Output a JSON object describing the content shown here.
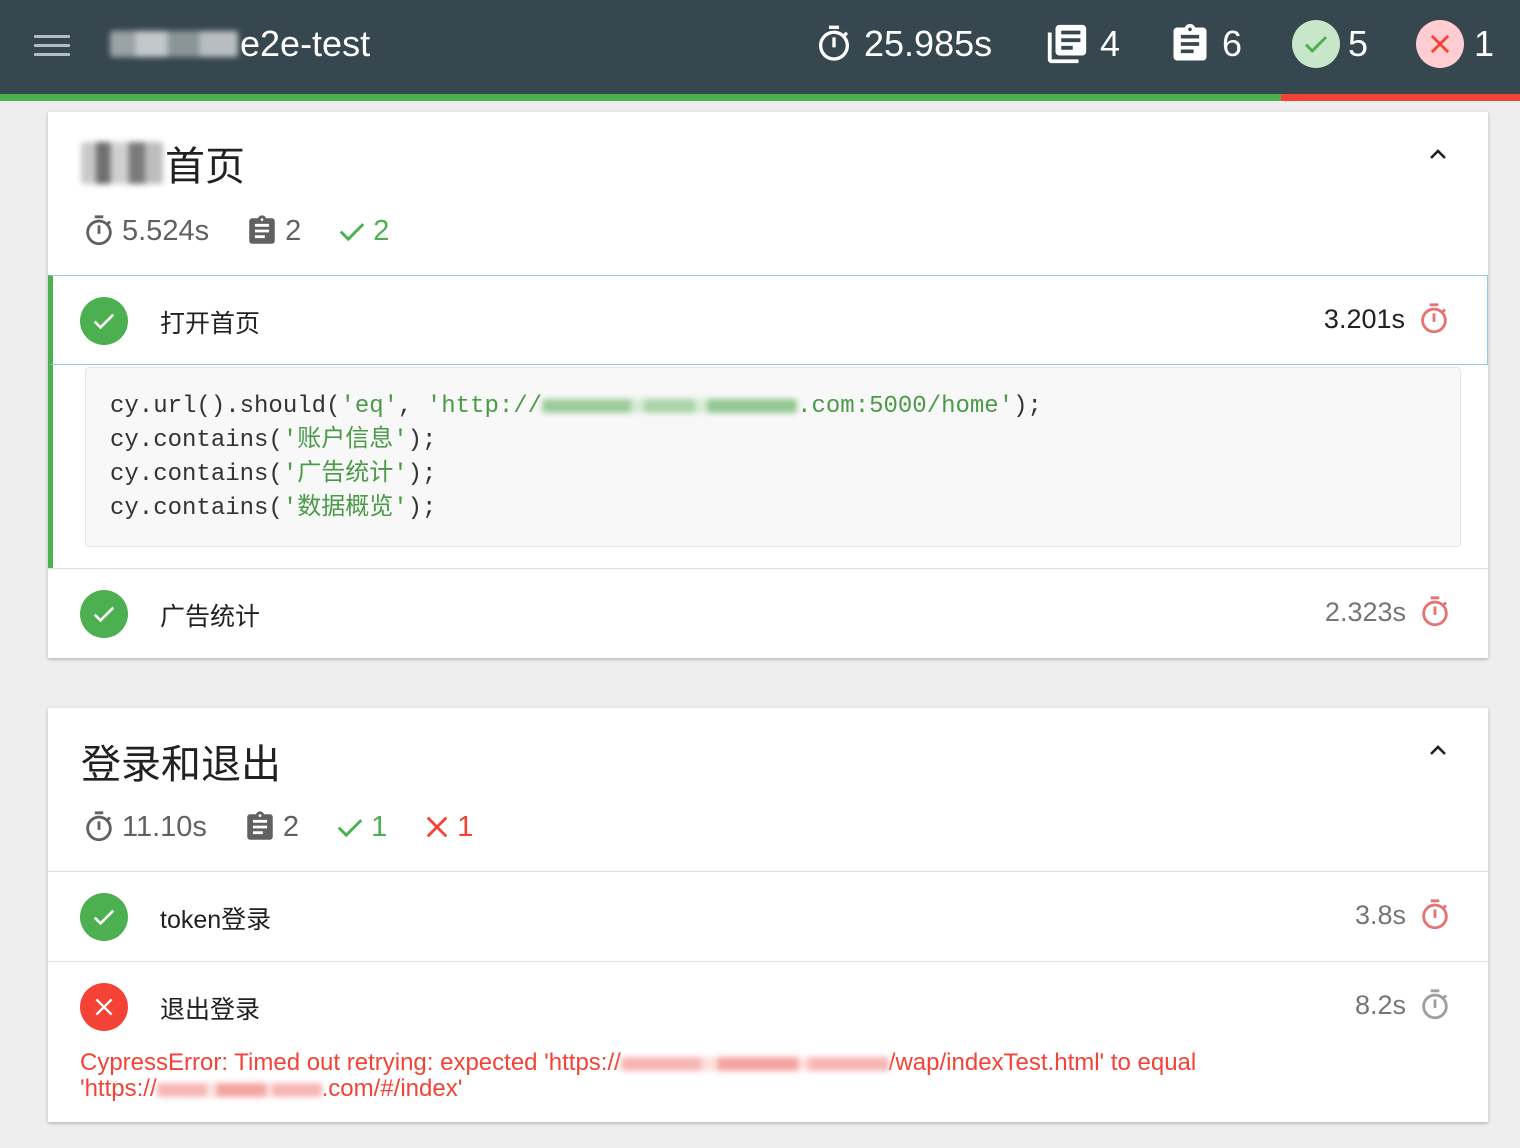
{
  "header": {
    "title": "e2e-test",
    "duration": "25.985s",
    "suites_count": "4",
    "tests_count": "6",
    "passed_count": "5",
    "failed_count": "1"
  },
  "progress": {
    "passed_fraction": 0.843,
    "failed_fraction": 0.157
  },
  "colors": {
    "topbar": "#37474f",
    "pass": "#4caf50",
    "fail": "#f44336",
    "pending_blue": "#90caf9"
  },
  "suites": [
    {
      "title": "首页",
      "duration": "5.524s",
      "tests_count": "2",
      "passed_count": "2",
      "tests": [
        {
          "name": "打开首页",
          "duration": "3.201s",
          "status": "pass",
          "code": {
            "line1_prefix": "cy.url().should(",
            "line1_s1": "'eq'",
            "line1_sep": ", ",
            "line1_s2a": "'http://",
            "line1_s2b": ".com:5000/home'",
            "line1_suffix": ");",
            "line2_prefix": "cy.contains(",
            "line2_s": "'账户信息'",
            "line2_suffix": ");",
            "line3_prefix": "cy.contains(",
            "line3_s": "'广告统计'",
            "line3_suffix": ");",
            "line4_prefix": "cy.contains(",
            "line4_s": "'数据概览'",
            "line4_suffix": ");"
          }
        },
        {
          "name": "广告统计",
          "duration": "2.323s",
          "status": "pass"
        }
      ]
    },
    {
      "title": "登录和退出",
      "duration": "11.10s",
      "tests_count": "2",
      "passed_count": "1",
      "failed_count": "1",
      "tests": [
        {
          "name": "token登录",
          "duration": "3.8s",
          "status": "pass"
        },
        {
          "name": "退出登录",
          "duration": "8.2s",
          "status": "fail",
          "error": {
            "part1": "CypressError: Timed out retrying: expected 'https://",
            "part2": "/wap/indexTest.html' to equal",
            "part3": "'https://",
            "part4": ".com/#/index'"
          }
        }
      ]
    }
  ],
  "icons": {
    "menu": "hamburger-icon",
    "duration": "stopwatch-icon",
    "suites": "library-books-icon",
    "tests": "clipboard-icon",
    "passed": "check-icon",
    "failed": "close-icon",
    "collapse": "chevron-up-icon"
  }
}
